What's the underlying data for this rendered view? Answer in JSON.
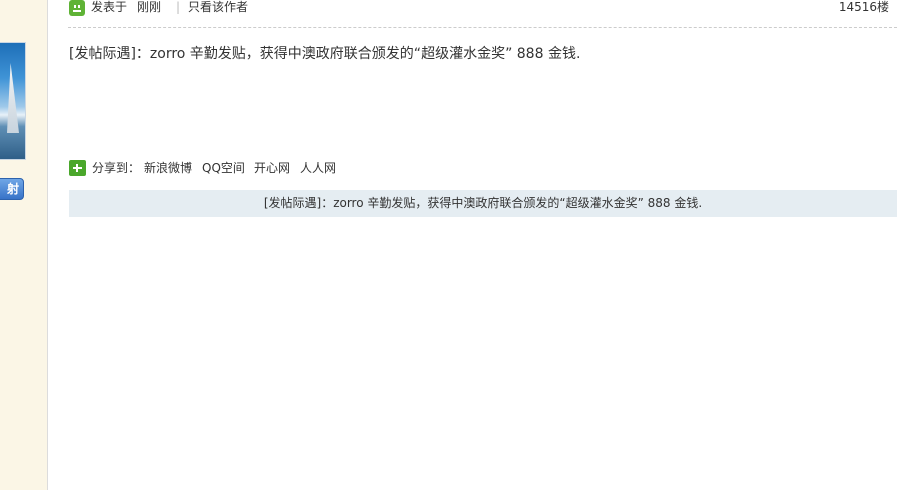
{
  "post": {
    "posted_label": "发表于",
    "time": "刚刚",
    "separator": "|",
    "only_author": "只看该作者",
    "floor": "14516楼",
    "message": "[发帖际遇]：zorro 辛勤发贴，获得中澳政府联合颁发的“超级灌水金奖” 888 金钱."
  },
  "share": {
    "label": "分享到：",
    "links": [
      "新浪微博",
      "QQ空间",
      "开心网",
      "人人网"
    ]
  },
  "reward_bar": {
    "text": "[发帖际遇]：zorro 辛勤发贴，获得中澳政府联合颁发的“超级灌水金奖” 888 金钱."
  },
  "sidebar": {
    "button_label": "射"
  },
  "colors": {
    "sidebar_bg": "#fbf6e6",
    "reward_bg": "#e5edf2",
    "icon_green": "#5fb336",
    "button_blue": "#3873c8"
  },
  "icons": {
    "online": "online-status-icon",
    "share": "plus-icon"
  }
}
